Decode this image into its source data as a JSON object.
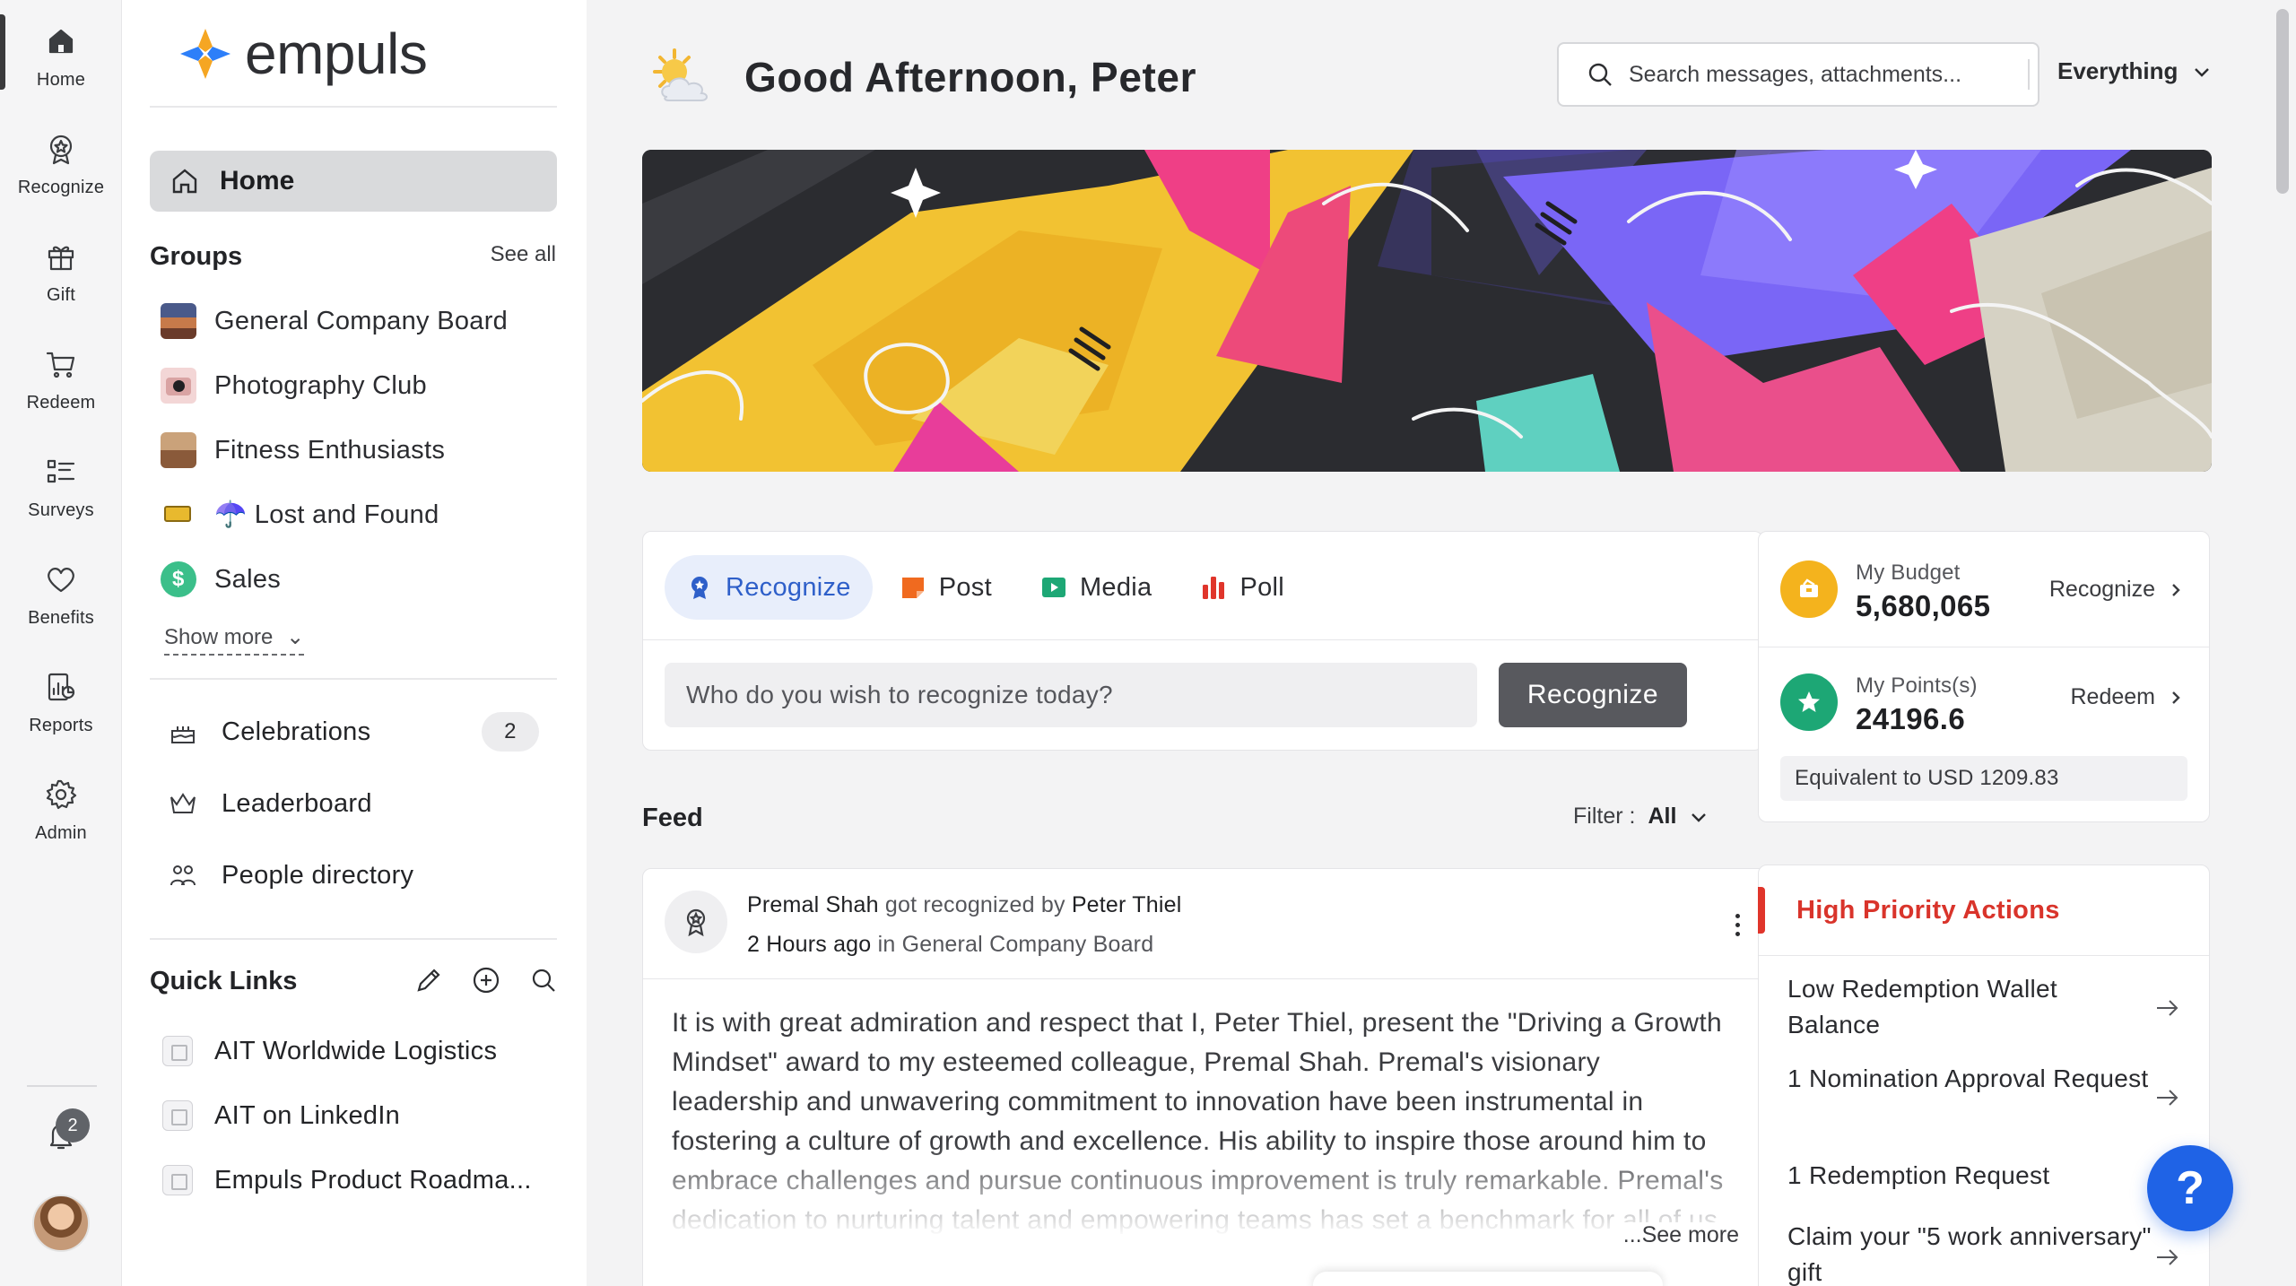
{
  "rail": {
    "items": [
      {
        "label": "Home",
        "icon": "home-icon"
      },
      {
        "label": "Recognize",
        "icon": "recognize-icon"
      },
      {
        "label": "Gift",
        "icon": "gift-icon"
      },
      {
        "label": "Redeem",
        "icon": "cart-icon"
      },
      {
        "label": "Surveys",
        "icon": "survey-list-icon"
      },
      {
        "label": "Benefits",
        "icon": "heart-icon"
      },
      {
        "label": "Reports",
        "icon": "reports-icon"
      },
      {
        "label": "Admin",
        "icon": "gear-icon"
      }
    ],
    "notification_count": "2"
  },
  "sidebar": {
    "logo_text": "empuls",
    "home_label": "Home",
    "groups_title": "Groups",
    "see_all": "See all",
    "groups": [
      {
        "label": "General Company Board"
      },
      {
        "label": "Photography Club"
      },
      {
        "label": "Fitness Enthusiasts"
      },
      {
        "label": "☂️ Lost and Found"
      },
      {
        "label": "Sales"
      }
    ],
    "show_more": "Show more",
    "nav": [
      {
        "label": "Celebrations",
        "count": "2"
      },
      {
        "label": "Leaderboard"
      },
      {
        "label": "People directory"
      }
    ],
    "quick_links_title": "Quick Links",
    "quick_links": [
      {
        "label": "AIT Worldwide Logistics"
      },
      {
        "label": "AIT on LinkedIn"
      },
      {
        "label": "Empuls Product Roadma..."
      }
    ]
  },
  "header": {
    "greeting": "Good Afternoon, Peter",
    "search_placeholder": "Search messages, attachments...",
    "scope": "Everything"
  },
  "composer": {
    "tabs": [
      {
        "label": "Recognize",
        "active": true
      },
      {
        "label": "Post"
      },
      {
        "label": "Media"
      },
      {
        "label": "Poll"
      }
    ],
    "placeholder": "Who do you wish to recognize today?",
    "button": "Recognize"
  },
  "feed": {
    "title": "Feed",
    "filter_label": "Filter :",
    "filter_value": "All",
    "post": {
      "recipient": "Premal Shah",
      "verb": "got recognized by",
      "giver": "Peter Thiel",
      "time": "2 Hours ago",
      "in_word": "in",
      "group": "General Company Board",
      "body": "It is with great admiration and respect that I, Peter Thiel, present the \"Driving a Growth Mindset\" award to my esteemed colleague, Premal Shah. Premal's visionary leadership and unwavering commitment to innovation have been instrumental in fostering a culture of growth and excellence. His ability to inspire those around him to embrace challenges and pursue continuous improvement is truly remarkable. Premal's dedication to nurturing talent and empowering teams has set a benchmark for all of us.",
      "see_more": "...See more"
    }
  },
  "budget": {
    "budget_label": "My Budget",
    "budget_value": "5,680,065",
    "budget_action": "Recognize",
    "points_label": "My Points(s)",
    "points_value": "24196.6",
    "points_action": "Redeem",
    "equivalent": "Equivalent to USD 1209.83"
  },
  "high_priority": {
    "title": "High Priority Actions",
    "items": [
      {
        "label": "Low Redemption Wallet Balance"
      },
      {
        "label": "1 Nomination Approval Request"
      },
      {
        "label": "1 Redemption Request"
      },
      {
        "label": "Claim your \"5 work anniversary\" gift"
      }
    ]
  },
  "help": {
    "label": "?"
  },
  "colors": {
    "accent_blue": "#1f63e6",
    "priority_red": "#d9342b",
    "active_tab_bg": "#e8eefb"
  }
}
